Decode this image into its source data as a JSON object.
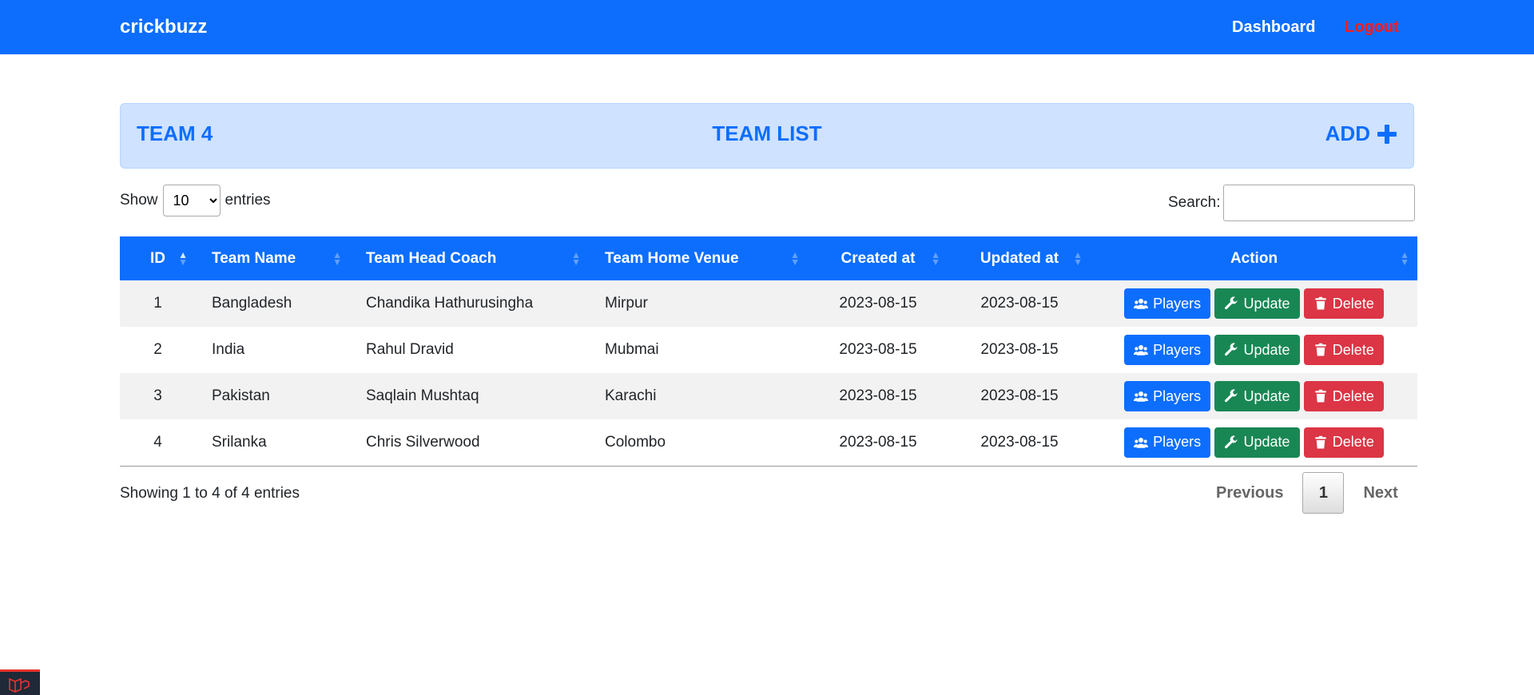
{
  "navbar": {
    "brand": "crickbuzz",
    "dashboard": "Dashboard",
    "logout": "Logout"
  },
  "header": {
    "left": "TEAM 4",
    "center": "TEAM LIST",
    "right": "ADD",
    "add_icon": "plus-icon"
  },
  "controls": {
    "show_label": "Show",
    "entries_label": "entries",
    "page_size": "10",
    "search_label": "Search:",
    "search_value": ""
  },
  "table": {
    "columns": [
      "ID",
      "Team Name",
      "Team Head Coach",
      "Team Home Venue",
      "Created at",
      "Updated at",
      "Action"
    ],
    "rows": [
      [
        "1",
        "Bangladesh",
        "Chandika Hathurusingha",
        "Mirpur",
        "2023-08-15",
        "2023-08-15"
      ],
      [
        "2",
        "India",
        "Rahul Dravid",
        "Mubmai",
        "2023-08-15",
        "2023-08-15"
      ],
      [
        "3",
        "Pakistan",
        "Saqlain Mushtaq",
        "Karachi",
        "2023-08-15",
        "2023-08-15"
      ],
      [
        "4",
        "Srilanka",
        "Chris Silverwood",
        "Colombo",
        "2023-08-15",
        "2023-08-15"
      ]
    ],
    "actions": {
      "players": "Players",
      "update": "Update",
      "delete": "Delete"
    }
  },
  "footer": {
    "info": "Showing 1 to 4 of 4 entries",
    "previous": "Previous",
    "current_page": "1",
    "next": "Next"
  },
  "colors": {
    "primary": "#0d6efd",
    "success": "#198754",
    "danger": "#dc3545",
    "logout": "#ff1a1a",
    "alert_bg": "#cfe2ff"
  }
}
